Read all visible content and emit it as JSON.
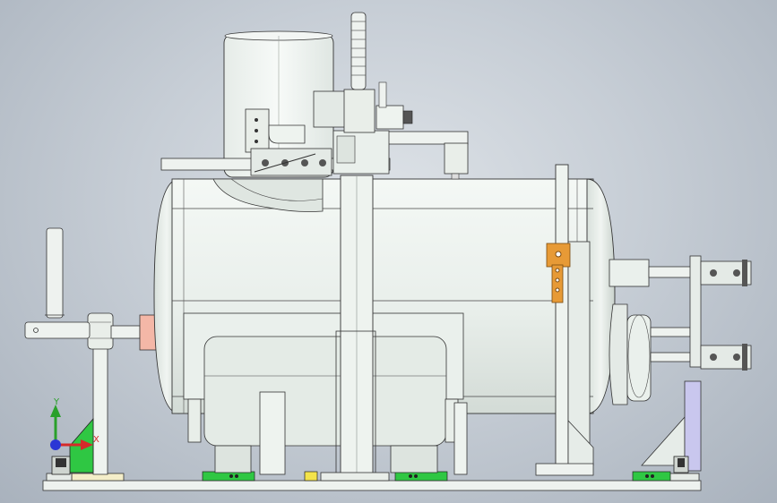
{
  "app": "CAD 3D viewport",
  "view": {
    "background_top": "#dde2e7",
    "background_bottom": "#a9b2bd",
    "model_color": "#eef3ef",
    "accent_green": "#22c23a",
    "accent_orange": "#e79a36",
    "accent_salmon": "#f4b7a7",
    "accent_violet": "#c9c7ee"
  },
  "triad": {
    "x_label": "X",
    "y_label": "Y",
    "x_color": "#d52a2a",
    "y_color": "#2aa02a",
    "z_color": "#2a36d5"
  }
}
